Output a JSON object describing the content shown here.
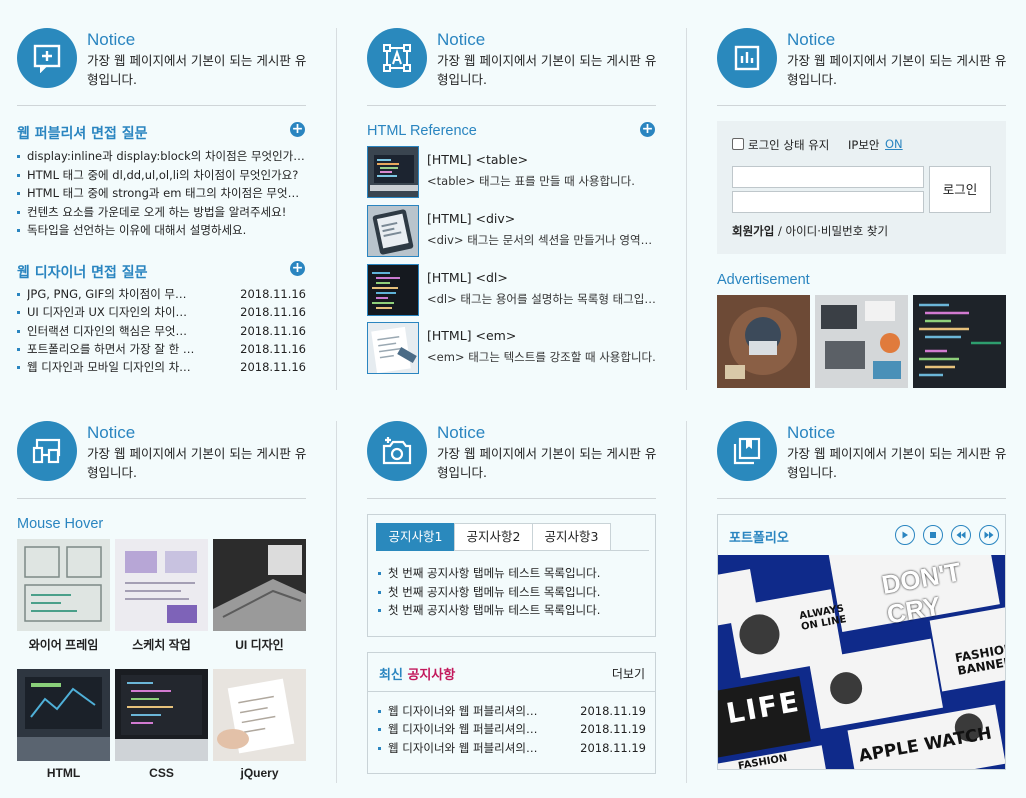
{
  "notice": {
    "title": "Notice",
    "desc": "가장 웹 페이지에서 기본이 되는 게시판 유형입니다."
  },
  "publisher": {
    "title": "웹 퍼블리셔 면접 질문",
    "plus": "+",
    "items": [
      "display:inline과 display:block의 차이점은 무엇인가요?",
      "HTML 태그 중에 dl,dd,ul,ol,li의 차이점이 무엇인가요?",
      "HTML 태그 중에 strong과 em 태그의 차이점은 무엇인가요?",
      "컨텐츠 요소를 가운데로 오게 하는 방법을 알려주세요!",
      "독타입을 선언하는 이유에 대해서 설명하세요."
    ]
  },
  "designer": {
    "title": "웹 디자이너 면접 질문",
    "plus": "+",
    "items": [
      {
        "t": "JPG, PNG, GIF의 차이점이 무엇인가요?",
        "d": "2018.11.16"
      },
      {
        "t": "UI 디자인과 UX 디자인의 차이점은?",
        "d": "2018.11.16"
      },
      {
        "t": "인터랙션 디자인의 핵심은 무엇인가요?",
        "d": "2018.11.16"
      },
      {
        "t": "포트폴리오를 하면서 가장 잘 한 점은?",
        "d": "2018.11.16"
      },
      {
        "t": "웹 디자인과 모바일 디자인의 차이점은?",
        "d": "2018.11.16"
      }
    ]
  },
  "reference": {
    "title": "HTML Reference",
    "plus": "+",
    "items": [
      {
        "t": "[HTML] <table>",
        "d": "<table> 태그는 표를 만들 때 사용합니다."
      },
      {
        "t": "[HTML] <div>",
        "d": "<div> 태그는 문서의 섹션을 만들거나 영역을 나눌 때 사용합니다."
      },
      {
        "t": "[HTML] <dl>",
        "d": "<dl> 태그는 용어를 설명하는 목록형 태그입니다."
      },
      {
        "t": "[HTML] <em>",
        "d": "<em> 태그는 텍스트를 강조할 때 사용합니다."
      }
    ]
  },
  "login": {
    "keep": "로그인 상태 유지",
    "ip": "IP보안",
    "ip_on": "ON",
    "button": "로그인",
    "join": "회원가입",
    "sep": "/",
    "find": "아이디·비밀번호 찾기"
  },
  "ad": {
    "title": "Advertisement"
  },
  "hover": {
    "title": "Mouse Hover",
    "items": [
      "와이어 프레임",
      "스케치 작업",
      "UI 디자인",
      "HTML",
      "CSS",
      "jQuery"
    ]
  },
  "tabs": {
    "labels": [
      "공지사항1",
      "공지사항2",
      "공지사항3"
    ],
    "items": [
      "첫 번째 공지사항 탭메뉴 테스트 목록입니다.",
      "첫 번째 공지사항 탭메뉴 테스트 목록입니다.",
      "첫 번째 공지사항 탭메뉴 테스트 목록입니다."
    ]
  },
  "latest": {
    "title_a": "최신 ",
    "title_b": "공지사항",
    "more": "더보기",
    "items": [
      {
        "t": "웹 디자이너와 웹 퍼블리셔의 차이",
        "d": "2018.11.19"
      },
      {
        "t": "웹 디자이너와 웹 퍼블리셔의 차이",
        "d": "2018.11.19"
      },
      {
        "t": "웹 디자이너와 웹 퍼블리셔의 차이",
        "d": "2018.11.19"
      }
    ]
  },
  "portfolio": {
    "title": "포트폴리오",
    "words": [
      "DON'T",
      "CRY",
      "ALWAYS",
      "ON LINE",
      "FASHION",
      "BANNER",
      "LIFE",
      "APPLE WATCH",
      "FASHION"
    ]
  },
  "colors": {
    "accent": "#2a85c0",
    "bg": "#f3fbfc",
    "pink": "#c2185b",
    "navy": "#0f2a8a"
  }
}
